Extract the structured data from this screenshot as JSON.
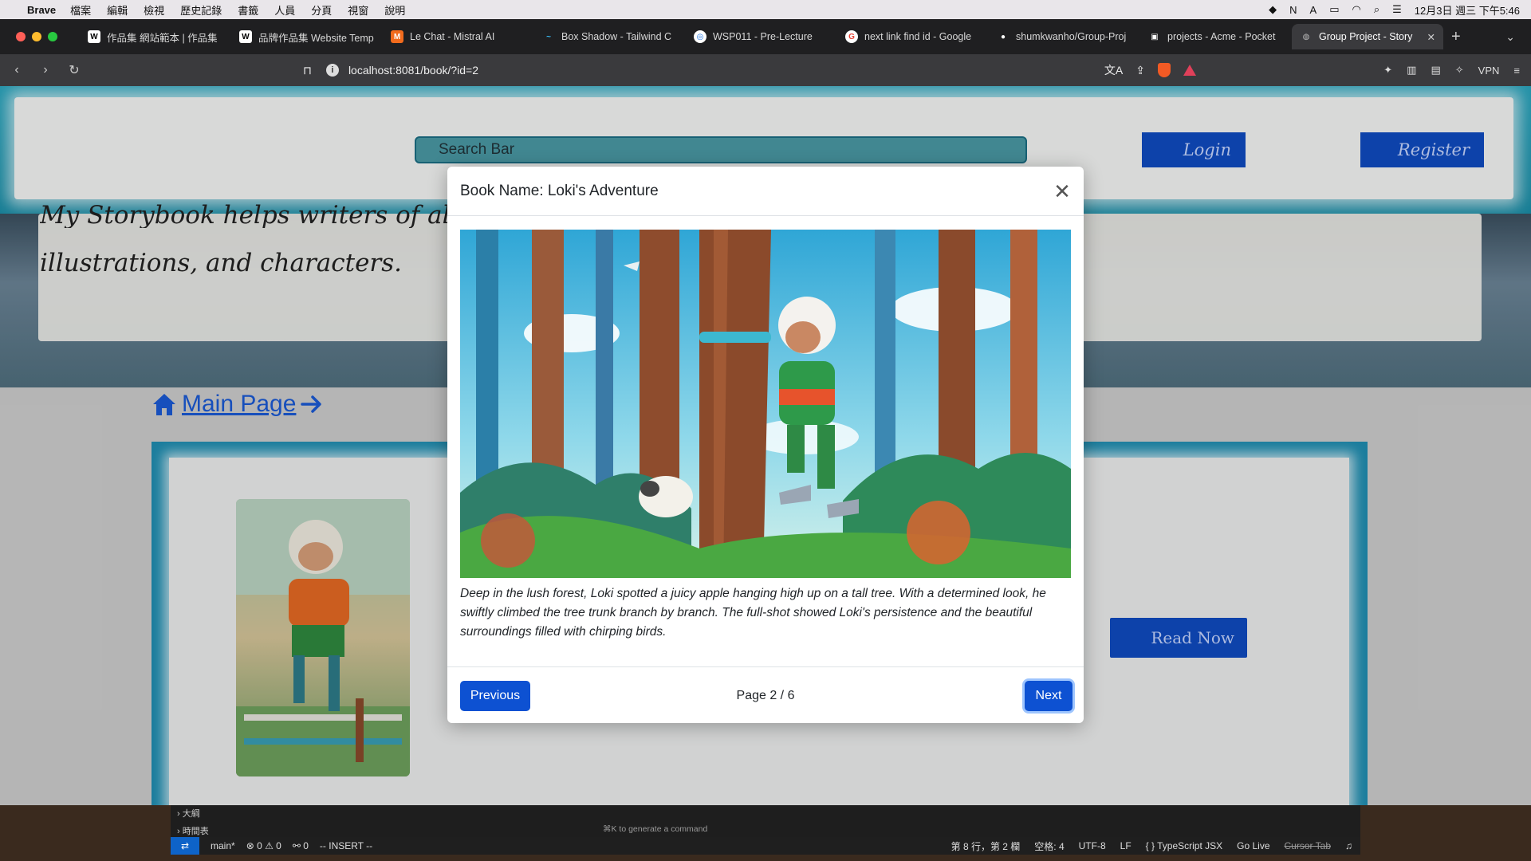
{
  "menubar": {
    "app": "Brave",
    "items": [
      "檔案",
      "編輯",
      "檢視",
      "歷史記錄",
      "書籤",
      "人員",
      "分頁",
      "視窗",
      "說明"
    ],
    "clock": "12月3日 週三 下午5:46"
  },
  "tabs": [
    {
      "label": "作品集 網站範本 | 作品集",
      "icon": "W"
    },
    {
      "label": "品牌作品集 Website Temp",
      "icon": "W"
    },
    {
      "label": "Le Chat - Mistral AI",
      "icon": "M"
    },
    {
      "label": "Box Shadow - Tailwind C",
      "icon": "~"
    },
    {
      "label": "WSP011 - Pre-Lecture",
      "icon": "◎"
    },
    {
      "label": "next link find id - Google",
      "icon": "G"
    },
    {
      "label": "shumkwanho/Group-Proj",
      "icon": "●"
    },
    {
      "label": "projects - Acme - Pocket",
      "icon": "▣"
    },
    {
      "label": "Group Project - Story",
      "icon": "◍",
      "active": true
    }
  ],
  "address": {
    "url": "localhost:8081/book/?id=2",
    "vpn": "VPN"
  },
  "page": {
    "search_placeholder": "Search Bar",
    "login_label": "Login",
    "register_label": "Register",
    "hero_line1": "My Storybook helps writers of all ages",
    "hero_line2": "illustrations, and characters.",
    "main_page_label": "Main Page",
    "read_now_label": "Read Now"
  },
  "modal": {
    "title": "Book Name: Loki's Adventure",
    "text": "Deep in the lush forest, Loki spotted a juicy apple hanging high up on a tall tree. With a determined look, he swiftly climbed the tree trunk branch by branch. The full-shot showed Loki's persistence and the beautiful surroundings filled with chirping birds.",
    "previous_label": "Previous",
    "next_label": "Next",
    "page_indicator": "Page 2 / 6",
    "current_page": 2,
    "total_pages": 6
  },
  "vscode": {
    "outline": "大綱",
    "timeline": "時間表",
    "hint": "⌘K to generate a command",
    "branch": "main*",
    "problems": "⊗ 0 ⚠ 0",
    "ports": "⚯ 0",
    "mode": "-- INSERT --",
    "position": "第 8 行，第 2 欄",
    "spaces": "空格: 4",
    "encoding": "UTF-8",
    "eol": "LF",
    "language": "{ } TypeScript JSX",
    "golive": "Go Live",
    "cursor_tab": "Cursor Tab"
  },
  "colors": {
    "primary": "#0d51d2",
    "header_teal": "#2aa7c0",
    "modal_bg": "#ffffff"
  }
}
